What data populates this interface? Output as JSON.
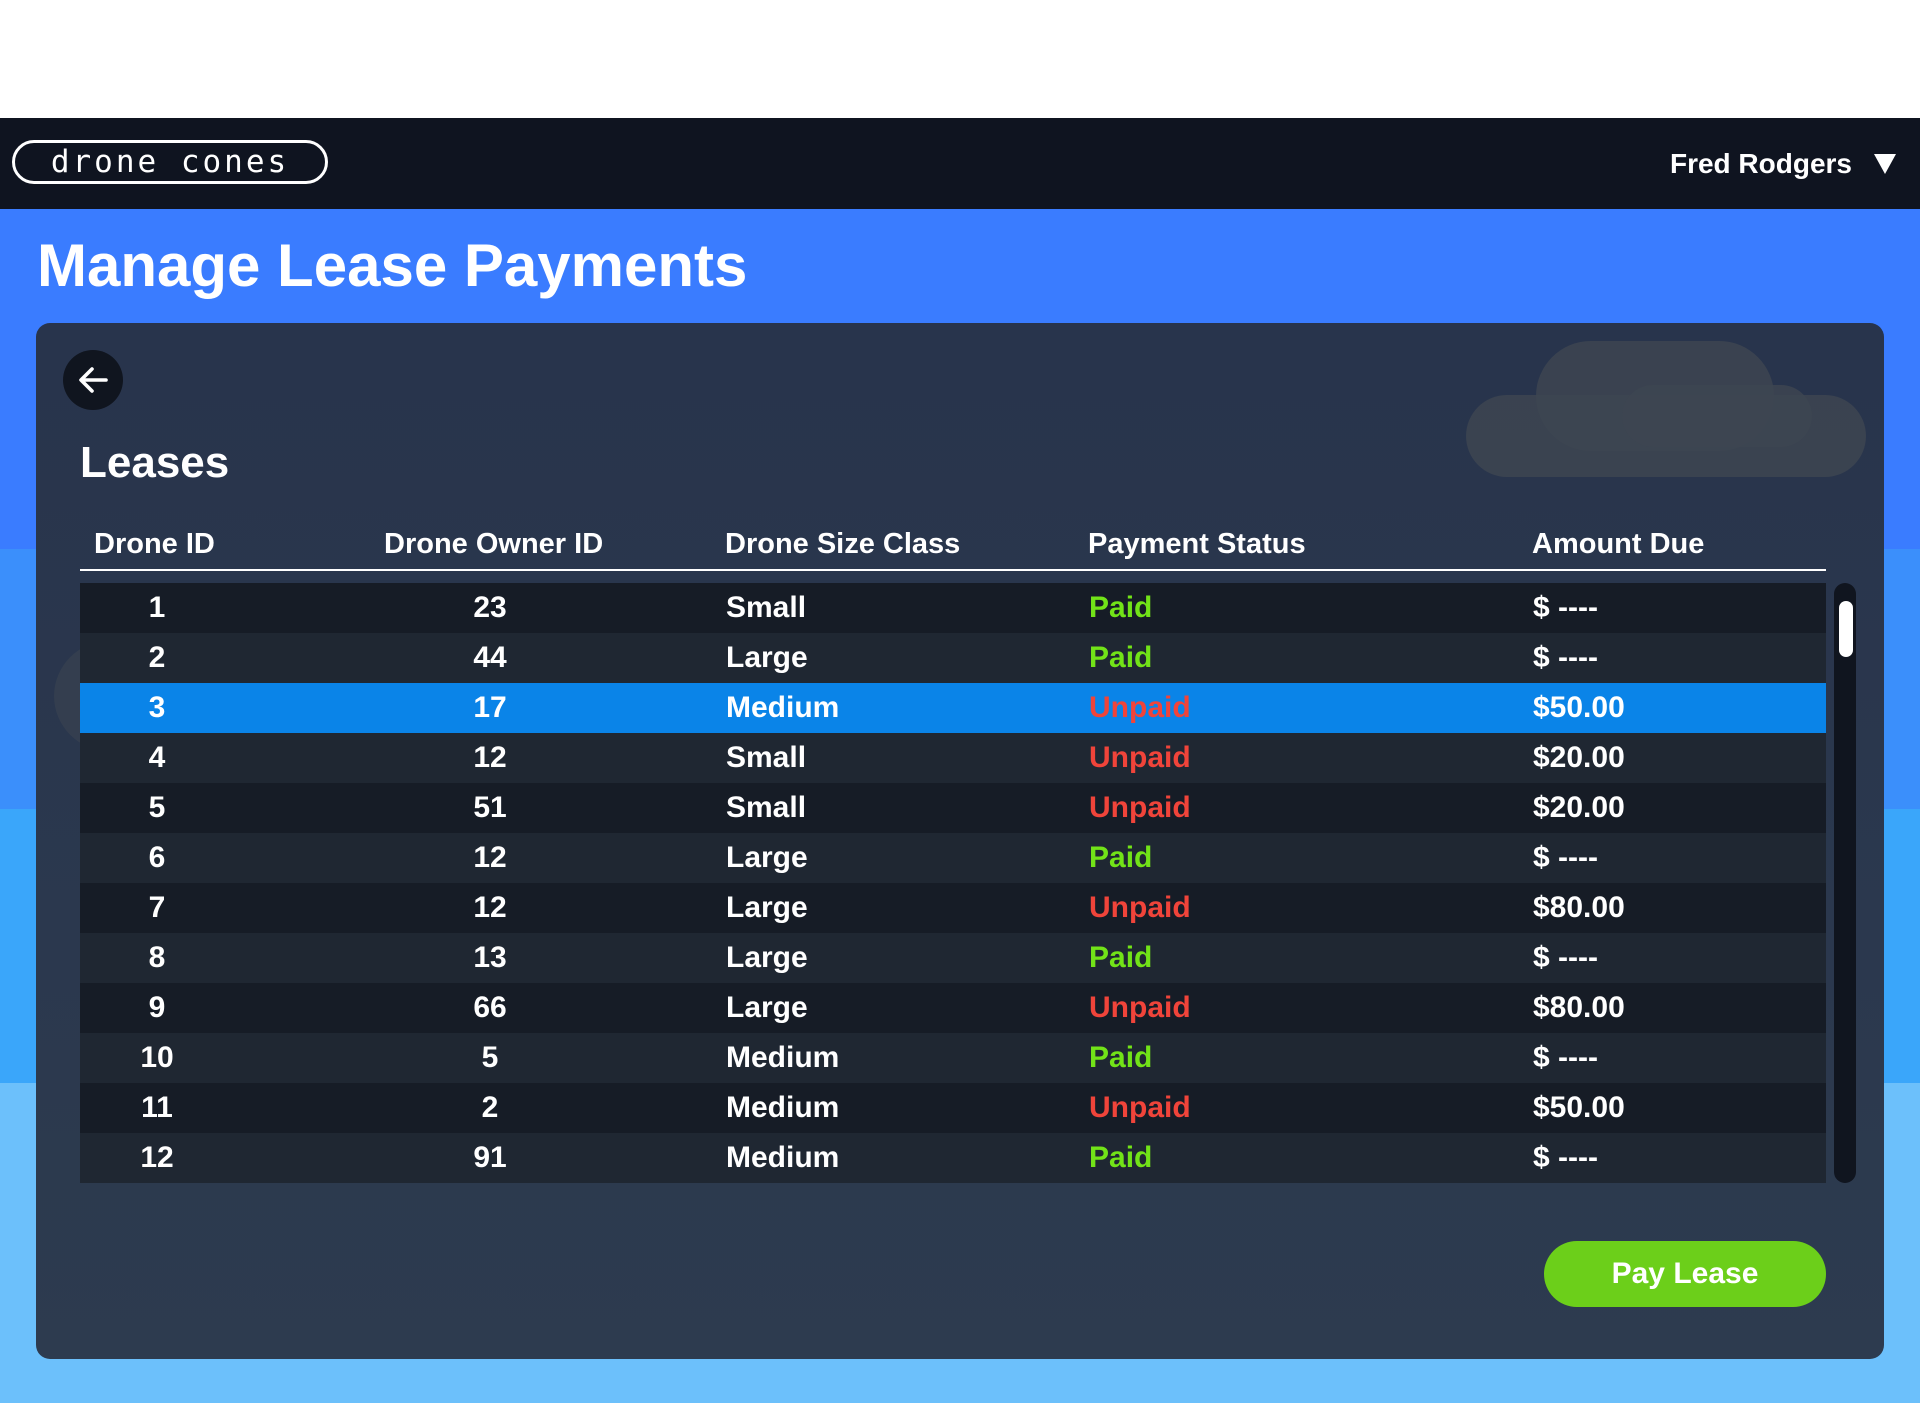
{
  "app": {
    "logo_text": "drone cones"
  },
  "navbar": {
    "user_name": "Fred Rodgers"
  },
  "page": {
    "title": "Manage Lease Payments"
  },
  "leases": {
    "section_title": "Leases",
    "columns": [
      "Drone ID",
      "Drone Owner ID",
      "Drone Size Class",
      "Payment Status",
      "Amount Due"
    ],
    "selected_row_index": 2,
    "rows": [
      {
        "drone_id": "1",
        "owner_id": "23",
        "size": "Small",
        "status": "Paid",
        "amount": "$ ----"
      },
      {
        "drone_id": "2",
        "owner_id": "44",
        "size": "Large",
        "status": "Paid",
        "amount": "$ ----"
      },
      {
        "drone_id": "3",
        "owner_id": "17",
        "size": "Medium",
        "status": "Unpaid",
        "amount": "$50.00"
      },
      {
        "drone_id": "4",
        "owner_id": "12",
        "size": "Small",
        "status": "Unpaid",
        "amount": "$20.00"
      },
      {
        "drone_id": "5",
        "owner_id": "51",
        "size": "Small",
        "status": "Unpaid",
        "amount": "$20.00"
      },
      {
        "drone_id": "6",
        "owner_id": "12",
        "size": "Large",
        "status": "Paid",
        "amount": "$ ----"
      },
      {
        "drone_id": "7",
        "owner_id": "12",
        "size": "Large",
        "status": "Unpaid",
        "amount": "$80.00"
      },
      {
        "drone_id": "8",
        "owner_id": "13",
        "size": "Large",
        "status": "Paid",
        "amount": "$ ----"
      },
      {
        "drone_id": "9",
        "owner_id": "66",
        "size": "Large",
        "status": "Unpaid",
        "amount": "$80.00"
      },
      {
        "drone_id": "10",
        "owner_id": "5",
        "size": "Medium",
        "status": "Paid",
        "amount": "$ ----"
      },
      {
        "drone_id": "11",
        "owner_id": "2",
        "size": "Medium",
        "status": "Unpaid",
        "amount": "$50.00"
      },
      {
        "drone_id": "12",
        "owner_id": "91",
        "size": "Medium",
        "status": "Paid",
        "amount": "$ ----"
      }
    ]
  },
  "actions": {
    "pay_label": "Pay Lease"
  },
  "icons": {
    "back": "arrow-left-icon",
    "user_menu": "caret-down-icon"
  },
  "colors": {
    "paid": "#72e318",
    "unpaid": "#f0443a",
    "selected_row": "#0a84e8",
    "accent_button": "#6ccf1a",
    "navbar": "#0f1420"
  }
}
